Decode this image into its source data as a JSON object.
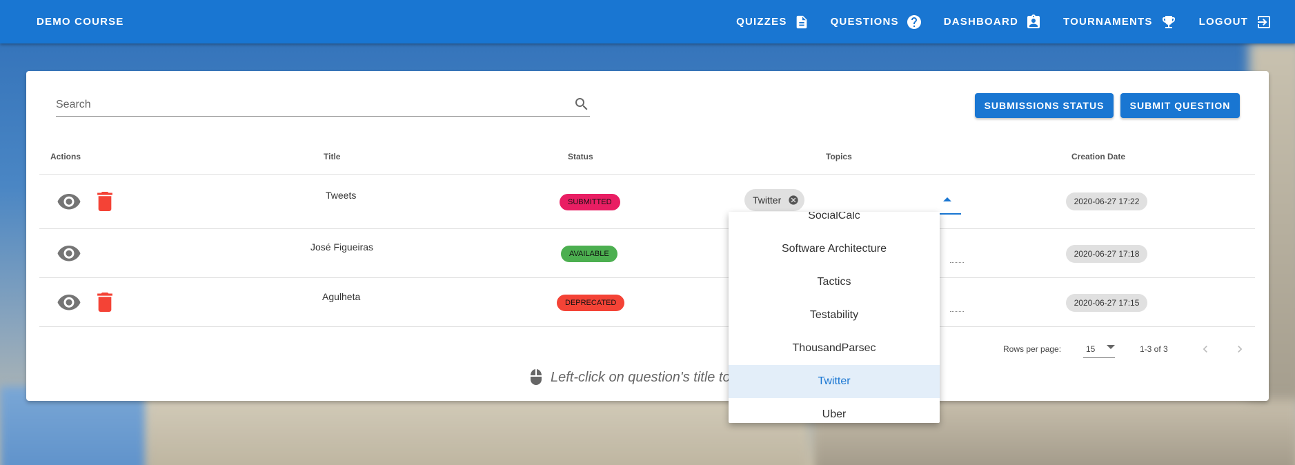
{
  "header": {
    "brand": "DEMO COURSE",
    "nav": [
      {
        "label": "QUIZZES",
        "icon": "file-document-icon"
      },
      {
        "label": "QUESTIONS",
        "icon": "help-circle-icon"
      },
      {
        "label": "DASHBOARD",
        "icon": "clipboard-account-icon"
      },
      {
        "label": "TOURNAMENTS",
        "icon": "trophy-icon"
      },
      {
        "label": "LOGOUT",
        "icon": "logout-icon"
      }
    ]
  },
  "search": {
    "placeholder": "Search"
  },
  "buttons": {
    "submissions_status": "SUBMISSIONS STATUS",
    "submit_question": "SUBMIT QUESTION"
  },
  "table": {
    "headers": {
      "actions": "Actions",
      "title": "Title",
      "status": "Status",
      "topics": "Topics",
      "creation_date": "Creation Date"
    },
    "rows": [
      {
        "title": "Tweets",
        "status": "SUBMITTED",
        "status_color": "#e91e63",
        "topic": "Twitter",
        "date": "2020-06-27 17:22"
      },
      {
        "title": "José Figueiras",
        "status": "AVAILABLE",
        "status_color": "#4caf50",
        "date": "2020-06-27 17:18"
      },
      {
        "title": "Agulheta",
        "status": "DEPRECATED",
        "status_color": "#f44336",
        "date": "2020-06-27 17:15"
      }
    ]
  },
  "footer": {
    "rows_per_page_label": "Rows per page:",
    "rows_per_page_value": "15",
    "range": "1-3 of 3"
  },
  "hint": "Left-click on question's title to",
  "topics_menu": {
    "items": [
      "SocialCalc",
      "Software Architecture",
      "Tactics",
      "Testability",
      "ThousandParsec",
      "Twitter",
      "Uber"
    ],
    "selected": "Twitter"
  },
  "colors": {
    "primary": "#1976d2",
    "delete": "#f44336"
  }
}
